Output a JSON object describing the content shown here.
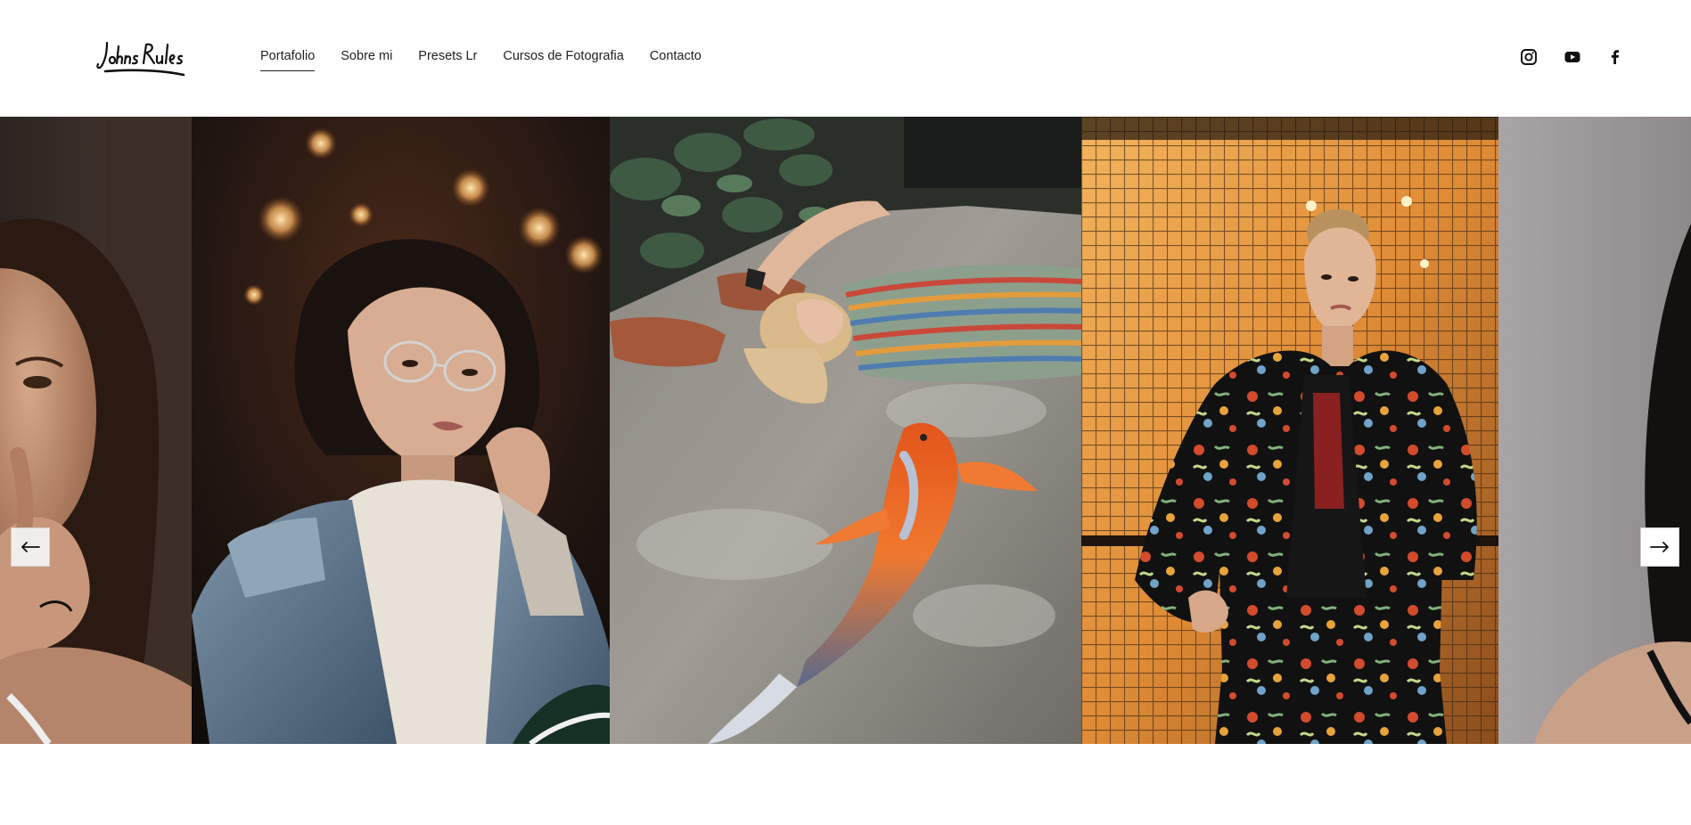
{
  "brand": {
    "logo_text": "Johns Rules"
  },
  "nav": {
    "items": [
      {
        "label": "Portafolio",
        "active": true
      },
      {
        "label": "Sobre mi",
        "active": false
      },
      {
        "label": "Presets Lr",
        "active": false
      },
      {
        "label": "Cursos de Fotografia",
        "active": false
      },
      {
        "label": "Contacto",
        "active": false
      }
    ]
  },
  "social": {
    "icons": [
      "instagram-icon",
      "youtube-icon",
      "facebook-icon"
    ]
  },
  "gallery": {
    "photos": [
      {
        "name": "woman-hand-on-chin-photo"
      },
      {
        "name": "woman-glasses-denim-jacket-photo"
      },
      {
        "name": "woman-lying-koi-fish-mural-photo"
      },
      {
        "name": "woman-floral-suit-mesh-wall-photo"
      },
      {
        "name": "woman-black-top-partial-photo"
      }
    ],
    "prev_icon": "arrow-left-icon",
    "next_icon": "arrow-right-icon"
  },
  "colors": {
    "text": "#1a1a1a",
    "background": "#ffffff",
    "accent": "#222222"
  }
}
